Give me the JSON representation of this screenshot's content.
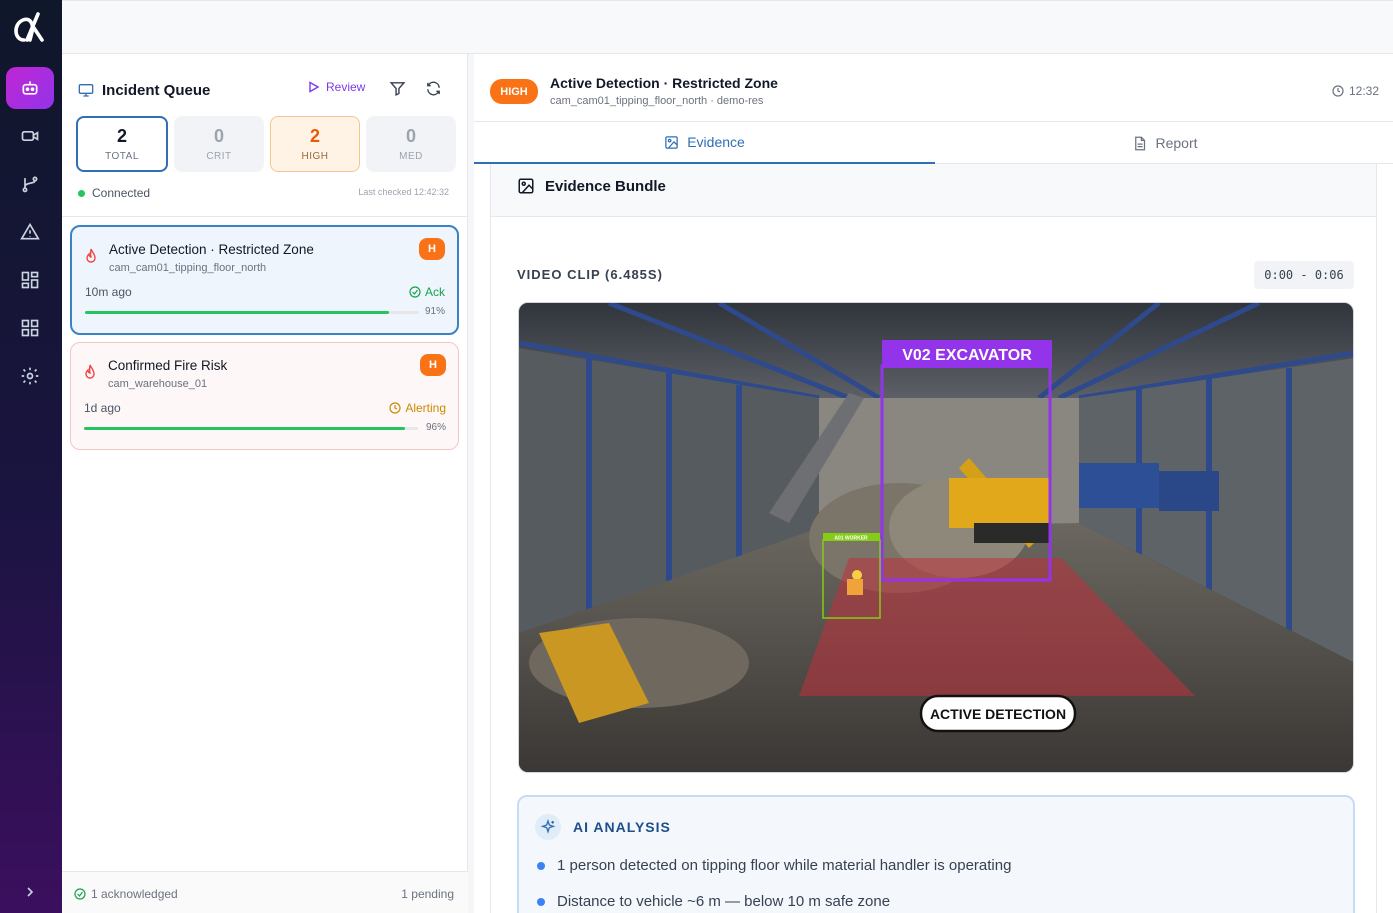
{
  "colors": {
    "accent": "#2f6fb3",
    "high": "#f97316",
    "ok": "#22c55e",
    "purple": "#9333ea"
  },
  "rail": {
    "items": [
      {
        "icon": "robot-icon",
        "active": true
      },
      {
        "icon": "video-camera-icon"
      },
      {
        "icon": "git-branch-icon"
      },
      {
        "icon": "alert-triangle-icon"
      },
      {
        "icon": "dashboard-grid-icon"
      },
      {
        "icon": "apps-grid-icon"
      },
      {
        "icon": "gear-icon"
      }
    ],
    "expand_icon": "chevron-right-icon"
  },
  "queue": {
    "title": "Incident Queue",
    "review_label": "Review",
    "stats": [
      {
        "value": "2",
        "label": "TOTAL"
      },
      {
        "value": "0",
        "label": "CRIT"
      },
      {
        "value": "2",
        "label": "HIGH"
      },
      {
        "value": "0",
        "label": "MED"
      }
    ],
    "connection": "Connected",
    "last_checked": "Last checked 12:42:32",
    "incidents": [
      {
        "title": "Active Detection · Restricted Zone",
        "camera": "cam_cam01_tipping_floor_north",
        "badge": "H",
        "ago": "10m ago",
        "status": "Ack",
        "confidence": 91,
        "confidence_label": "91%"
      },
      {
        "title": "Confirmed Fire Risk",
        "camera": "cam_warehouse_01",
        "badge": "H",
        "ago": "1d ago",
        "status": "Alerting",
        "confidence": 96,
        "confidence_label": "96%"
      }
    ],
    "footer": {
      "acknowledged": "1 acknowledged",
      "pending": "1 pending"
    }
  },
  "detail": {
    "severity": "HIGH",
    "title": "Active Detection · Restricted Zone",
    "subtitle": "cam_cam01_tipping_floor_north · demo-res",
    "time": "12:32",
    "tabs": [
      {
        "label": "Evidence"
      },
      {
        "label": "Report"
      }
    ],
    "bundle_title": "Evidence Bundle",
    "clip_label": "VIDEO CLIP (6.485S)",
    "clip_range": "0:00 - 0:06",
    "video": {
      "vehicle_label": "V02 EXCAVATOR",
      "worker_label": "A01 WORKER",
      "overlay_label": "ACTIVE DETECTION"
    },
    "ai": {
      "title": "AI ANALYSIS",
      "items": [
        "1 person detected on tipping floor while material handler is operating",
        "Distance to vehicle ~6 m — below 10 m safe zone"
      ]
    }
  }
}
